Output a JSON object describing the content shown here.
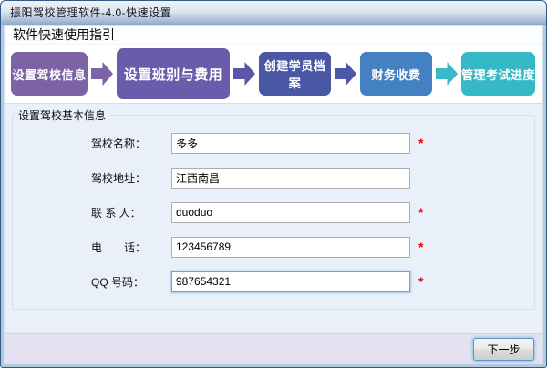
{
  "window": {
    "title": "振阳驾校管理软件-4.0-快速设置"
  },
  "guide": {
    "title": "软件快速使用指引"
  },
  "steps": {
    "items": [
      {
        "label": "设置驾校信息",
        "color": "#7d63a6"
      },
      {
        "label": "设置班别与费用",
        "color": "#6a5cab"
      },
      {
        "label": "创建学员档案",
        "color": "#4a57a5"
      },
      {
        "label": "财务收费",
        "color": "#4381c3"
      },
      {
        "label": "管理考试进度",
        "color": "#35b9c6"
      }
    ],
    "arrows": [
      {
        "color": "#7b64a8"
      },
      {
        "color": "#5d55a8"
      },
      {
        "color": "#4a58a8"
      },
      {
        "color": "#3bb7c8"
      }
    ]
  },
  "form": {
    "section_title": "设置驾校基本信息",
    "fields": [
      {
        "label": "驾校名称：",
        "value": "多多",
        "required": "*"
      },
      {
        "label": "驾校地址：",
        "value": "江西南昌",
        "required": ""
      },
      {
        "label": "联 系 人：",
        "value": "duoduo",
        "required": "*"
      },
      {
        "label": "电　　话：",
        "value": "123456789",
        "required": "*"
      },
      {
        "label": "QQ 号码：",
        "value": "987654321",
        "required": "*"
      }
    ]
  },
  "footer": {
    "next_label": "下一步"
  }
}
